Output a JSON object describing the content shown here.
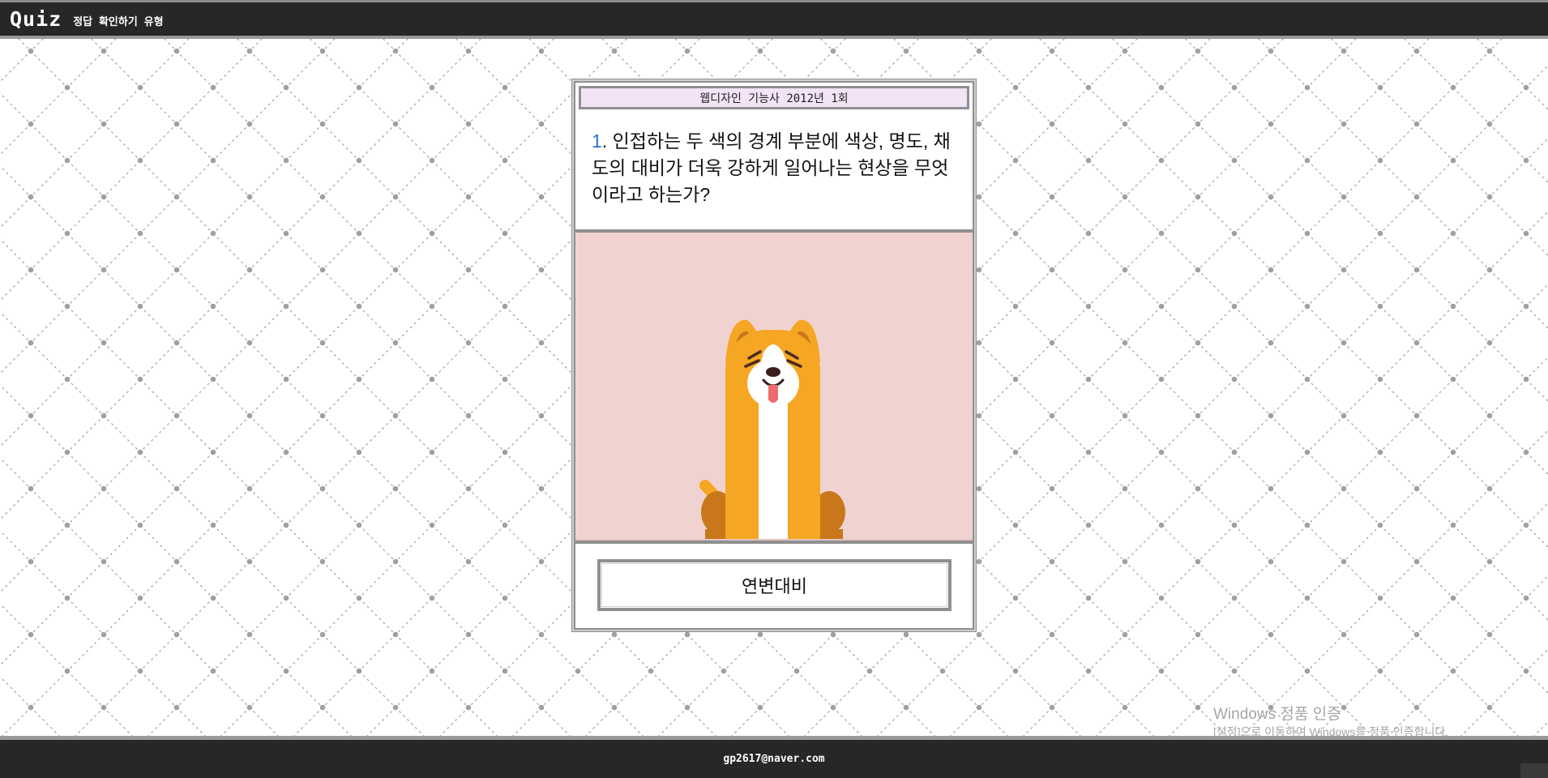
{
  "header": {
    "logo": "Quiz",
    "subtitle": "정답 확인하기 유형"
  },
  "card": {
    "title": "웹디자인 기능사 2012년 1회",
    "question": {
      "number": "1",
      "text": ". 인접하는 두 색의 경계 부분에 색상, 명도, 채도의 대비가 더욱 강하게 일어나는 현상을 무엇이라고 하는가?"
    },
    "illustration": "corgi-dog-illustration",
    "answer_label": "연변대비"
  },
  "footer": {
    "email": "gp2617@naver.com"
  },
  "watermark": {
    "title": "Windows 정품 인증",
    "subtitle": "[설정]으로 이동하여 Windows를 정품 인증합니다."
  },
  "colors": {
    "header_bg": "#272727",
    "card_border": "#8f8f8f",
    "title_bg": "#f2e3f6",
    "image_bg": "#f0d3d1",
    "question_number": "#2b6fd0",
    "dog_orange": "#f5a623"
  }
}
